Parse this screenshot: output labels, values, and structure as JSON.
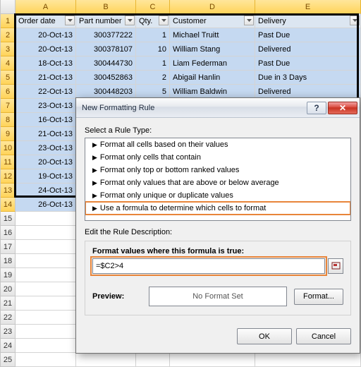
{
  "columns": [
    "A",
    "B",
    "C",
    "D",
    "E"
  ],
  "headers": [
    "Order date",
    "Part number",
    "Qty.",
    "Customer",
    "Delivery"
  ],
  "rows": [
    {
      "n": 1,
      "date": "20-Oct-13",
      "part": "300377222",
      "qty": "1",
      "cust": "Michael Truitt",
      "deliv": "Past Due"
    },
    {
      "n": 2,
      "date": "20-Oct-13",
      "part": "300378107",
      "qty": "10",
      "cust": "William Stang",
      "deliv": "Delivered"
    },
    {
      "n": 3,
      "date": "18-Oct-13",
      "part": "300444730",
      "qty": "1",
      "cust": "Liam Federman",
      "deliv": "Past Due"
    },
    {
      "n": 4,
      "date": "21-Oct-13",
      "part": "300452863",
      "qty": "2",
      "cust": "Abigail Hanlin",
      "deliv": "Due in 3 Days"
    },
    {
      "n": 5,
      "date": "22-Oct-13",
      "part": "300448203",
      "qty": "5",
      "cust": "William Baldwin",
      "deliv": "Delivered"
    },
    {
      "n": 6,
      "date": "23-Oct-13",
      "part": "",
      "qty": "",
      "cust": "",
      "deliv": ""
    },
    {
      "n": 7,
      "date": "16-Oct-13",
      "part": "",
      "qty": "",
      "cust": "",
      "deliv": ""
    },
    {
      "n": 8,
      "date": "21-Oct-13",
      "part": "",
      "qty": "",
      "cust": "",
      "deliv": ""
    },
    {
      "n": 9,
      "date": "23-Oct-13",
      "part": "",
      "qty": "",
      "cust": "",
      "deliv": ""
    },
    {
      "n": 10,
      "date": "20-Oct-13",
      "part": "",
      "qty": "",
      "cust": "",
      "deliv": ""
    },
    {
      "n": 11,
      "date": "19-Oct-13",
      "part": "",
      "qty": "",
      "cust": "",
      "deliv": ""
    },
    {
      "n": 12,
      "date": "24-Oct-13",
      "part": "",
      "qty": "",
      "cust": "",
      "deliv": ""
    },
    {
      "n": 13,
      "date": "26-Oct-13",
      "part": "",
      "qty": "",
      "cust": "",
      "deliv": ""
    }
  ],
  "empty_rows": [
    15,
    16,
    17,
    18,
    19,
    20,
    21,
    22,
    23,
    24,
    25
  ],
  "dialog": {
    "title": "New Formatting Rule",
    "select_label": "Select a Rule Type:",
    "rule_types": [
      "Format all cells based on their values",
      "Format only cells that contain",
      "Format only top or bottom ranked values",
      "Format only values that are above or below average",
      "Format only unique or duplicate values",
      "Use a formula to determine which cells to format"
    ],
    "edit_label": "Edit the Rule Description:",
    "formula_label": "Format values where this formula is true:",
    "formula_value": "=$C2>4",
    "preview_label": "Preview:",
    "preview_text": "No Format Set",
    "format_btn": "Format...",
    "ok": "OK",
    "cancel": "Cancel"
  }
}
